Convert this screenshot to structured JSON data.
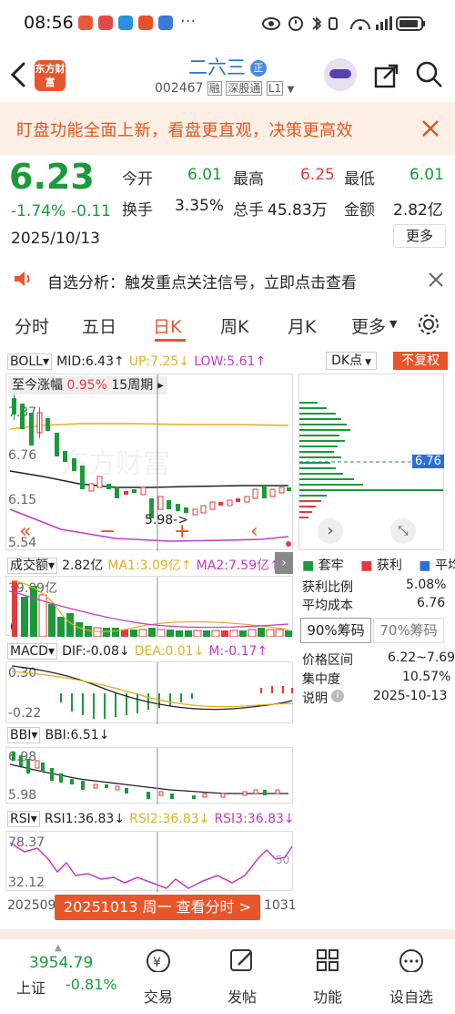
{
  "status": {
    "time": "08:56"
  },
  "header": {
    "logo": "东方财富",
    "stock_name": "二六三",
    "badge": "正",
    "code": "002467",
    "tags": [
      "融",
      "深股通",
      "L1"
    ]
  },
  "banner": {
    "text": "盯盘功能全面上新，看盘更直观，决策更高效"
  },
  "quote": {
    "price": "6.23",
    "change_pct": "-1.74%",
    "change": "-0.11",
    "date": "2025/10/13",
    "more_label": "更多",
    "fields": [
      {
        "label": "今开",
        "value": "6.01"
      },
      {
        "label": "最高",
        "value": "6.25"
      },
      {
        "label": "最低",
        "value": "6.01"
      },
      {
        "label": "换手",
        "value": "3.35%"
      },
      {
        "label": "总手",
        "value": "45.83万"
      },
      {
        "label": "金额",
        "value": "2.82亿"
      }
    ]
  },
  "notice": {
    "text": "自选分析：触发重点关注信号，立即点击查看"
  },
  "tabs": [
    {
      "label": "分时"
    },
    {
      "label": "五日"
    },
    {
      "label": "日K"
    },
    {
      "label": "周K"
    },
    {
      "label": "月K"
    },
    {
      "label": "更多"
    }
  ],
  "active_tab": "日K",
  "boll": {
    "name": "BOLL",
    "mid": "MID:6.43↑",
    "up": "UP:7.25↓",
    "low": "LOW:5.61↑",
    "dk": "DK点",
    "fq": "不复权",
    "period_label": "至今涨幅",
    "period_pct": "0.95%",
    "period_days": "15周期",
    "y_top": "7.37",
    "y_mid1": "6.76",
    "y_mid2": "6.15",
    "y_bot": "5.54",
    "min_label": "5.98->"
  },
  "volume": {
    "name": "成交额",
    "val": "2.82亿",
    "ma1": "MA1:3.09亿↑",
    "ma2": "MA2:7.59亿↑",
    "y_top": "39.09亿",
    "y_bot": "0"
  },
  "macd": {
    "name": "MACD",
    "dif": "DIF:-0.08↓",
    "dea": "DEA:0.01↓",
    "m": "M:-0.17↑",
    "y_top": "0.30",
    "y_bot": "-0.22"
  },
  "bbi": {
    "name": "BBI",
    "val": "BBI:6.51↓",
    "y_top": "6.98",
    "y_bot": "5.98"
  },
  "rsi": {
    "name": "RSI",
    "r1": "RSI1:36.83↓",
    "r2": "RSI2:36.83↓",
    "r3": "RSI3:36.83↓",
    "y_top": "78.37",
    "y_bot": "32.12",
    "marker": "50"
  },
  "xaxis": {
    "left": "20250905",
    "right": "1031"
  },
  "crosshair_label": "20251013 周一 查看分时 >",
  "chip": {
    "price_marker": "6.76",
    "legend": [
      "套牢",
      "获利",
      "平均"
    ],
    "profit_ratio_label": "获利比例",
    "profit_ratio": "5.08%",
    "avg_cost_label": "平均成本",
    "avg_cost": "6.76",
    "tab90": "90%筹码",
    "tab70": "70%筹码",
    "range_label": "价格区间",
    "range": "6.22~7.69",
    "conc_label": "集中度",
    "conc": "10.57%",
    "note_label": "说明",
    "note_date": "2025-10-13"
  },
  "bottom": {
    "index_value": "3954.79",
    "index_name": "上证",
    "index_change": "-0.81%",
    "items": [
      {
        "label": "交易"
      },
      {
        "label": "发帖"
      },
      {
        "label": "功能"
      },
      {
        "label": "设自选"
      }
    ]
  },
  "colors": {
    "red": "#e23b3b",
    "green": "#1a9a3a",
    "orange": "#e0561b",
    "blue": "#2a6fd6",
    "purple": "#c23bc2",
    "yellow": "#e0b020"
  }
}
